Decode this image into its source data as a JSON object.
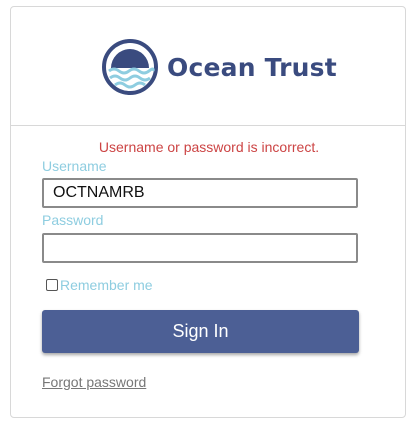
{
  "brand": {
    "name": "Ocean Trust",
    "logo_icon": "sun-over-waves-logo-icon",
    "primary_color": "#3a4b7f",
    "accent_color": "#8ecde0"
  },
  "login": {
    "error_message": "Username or password is incorrect.",
    "username_label": "Username",
    "username_value": "OCTNAMRB",
    "password_label": "Password",
    "password_value": "",
    "remember_label": "Remember me",
    "remember_checked": false,
    "signin_label": "Sign In",
    "forgot_label": "Forgot password",
    "error_color": "#cc4444",
    "button_color": "#4c5f95"
  }
}
